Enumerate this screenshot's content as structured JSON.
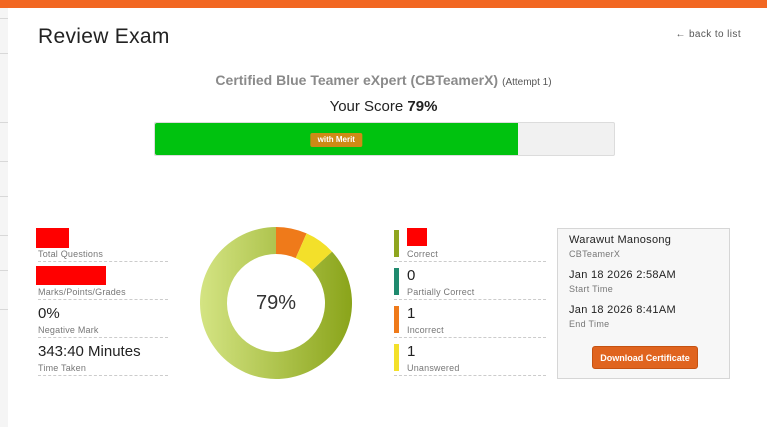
{
  "header": {
    "title": "Review Exam",
    "back_label": "back to list",
    "accent_color": "#f26722"
  },
  "exam": {
    "name": "Certified Blue Teamer eXpert (CBTeamerX)",
    "attempt": "(Attempt 1)"
  },
  "score": {
    "label": "Your Score",
    "value": "79%",
    "percent": 79,
    "badge": "with Merit",
    "bar_color": "#00c20f"
  },
  "stats": [
    {
      "value": "",
      "label": "Total Questions",
      "redacted": true
    },
    {
      "value": "",
      "label": "Marks/Points/Grades",
      "redacted": true
    },
    {
      "value": "0%",
      "label": "Negative Mark"
    },
    {
      "value": "343:40 Minutes",
      "label": "Time Taken"
    }
  ],
  "chart_data": {
    "type": "pie",
    "title": "",
    "center_label": "79%",
    "categories": [
      "Correct",
      "Partially Correct",
      "Incorrect",
      "Unanswered"
    ],
    "values": [
      79,
      0,
      6,
      6
    ],
    "colors": [
      "#8fab1f",
      "#1f8a6e",
      "#ef7a1a",
      "#f3e02a"
    ]
  },
  "legend": [
    {
      "value": "",
      "label": "Correct",
      "color": "#8fa51f",
      "redacted": true
    },
    {
      "value": "0",
      "label": "Partially Correct",
      "color": "#1f8a6e"
    },
    {
      "value": "1",
      "label": "Incorrect",
      "color": "#ef7a1a"
    },
    {
      "value": "1",
      "label": "Unanswered",
      "color": "#f3e02a"
    }
  ],
  "certificate": {
    "name": "Warawut Manosong",
    "course": "CBTeamerX",
    "start_value": "Jan 18 2026 2:58AM",
    "start_label": "Start Time",
    "end_value": "Jan 18 2026 8:41AM",
    "end_label": "End Time",
    "button": "Download Certificate"
  }
}
